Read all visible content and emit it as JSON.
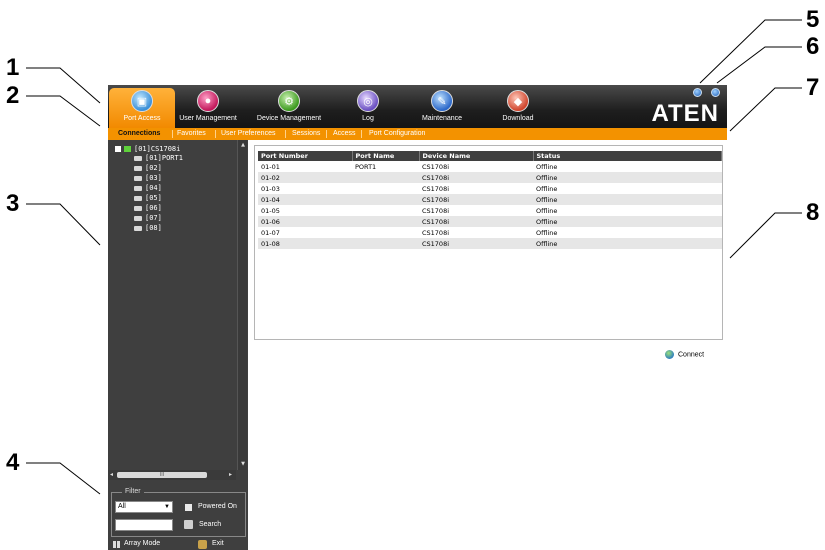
{
  "callouts": [
    "1",
    "2",
    "3",
    "4",
    "5",
    "6",
    "7",
    "8"
  ],
  "nav": {
    "tabs": [
      {
        "label": "Port Access",
        "icon": "port-access-icon"
      },
      {
        "label": "User Management",
        "icon": "user-management-icon"
      },
      {
        "label": "Device Management",
        "icon": "device-management-icon"
      },
      {
        "label": "Log",
        "icon": "log-icon"
      },
      {
        "label": "Maintenance",
        "icon": "maintenance-icon"
      },
      {
        "label": "Download",
        "icon": "download-icon"
      }
    ],
    "active_tab": "Port Access",
    "logo": "ATEN"
  },
  "subnav": {
    "items": [
      "Connections",
      "Favorites",
      "User Preferences",
      "Sessions",
      "Access",
      "Port Configuration"
    ],
    "active": "Connections"
  },
  "sidebar": {
    "tree": {
      "root": "[01]CS1708i",
      "children": [
        "[01]PORT1",
        "[02]",
        "[03]",
        "[04]",
        "[05]",
        "[06]",
        "[07]",
        "[08]"
      ]
    },
    "hscroll_thumb": "III",
    "filter": {
      "legend": "Filter",
      "select_value": "All",
      "powered_on_label": "Powered On",
      "search_label": "Search"
    },
    "array_mode_label": "Array Mode",
    "exit_label": "Exit"
  },
  "table": {
    "headers": [
      "Port Number",
      "Port Name",
      "Device Name",
      "Status"
    ],
    "rows": [
      [
        "01-01",
        "PORT1",
        "CS1708i",
        "Offline"
      ],
      [
        "01-02",
        "",
        "CS1708i",
        "Offline"
      ],
      [
        "01-03",
        "",
        "CS1708i",
        "Offline"
      ],
      [
        "01-04",
        "",
        "CS1708i",
        "Offline"
      ],
      [
        "01-05",
        "",
        "CS1708i",
        "Offline"
      ],
      [
        "01-06",
        "",
        "CS1708i",
        "Offline"
      ],
      [
        "01-07",
        "",
        "CS1708i",
        "Offline"
      ],
      [
        "01-08",
        "",
        "CS1708i",
        "Offline"
      ]
    ]
  },
  "connect_label": "Connect",
  "colors": {
    "accent": "#f39200",
    "topbar": "#1e1e1e",
    "sidebar": "#3f3f3f",
    "header_row": "#3f3f3f",
    "alt_row": "#e6e6e6"
  }
}
